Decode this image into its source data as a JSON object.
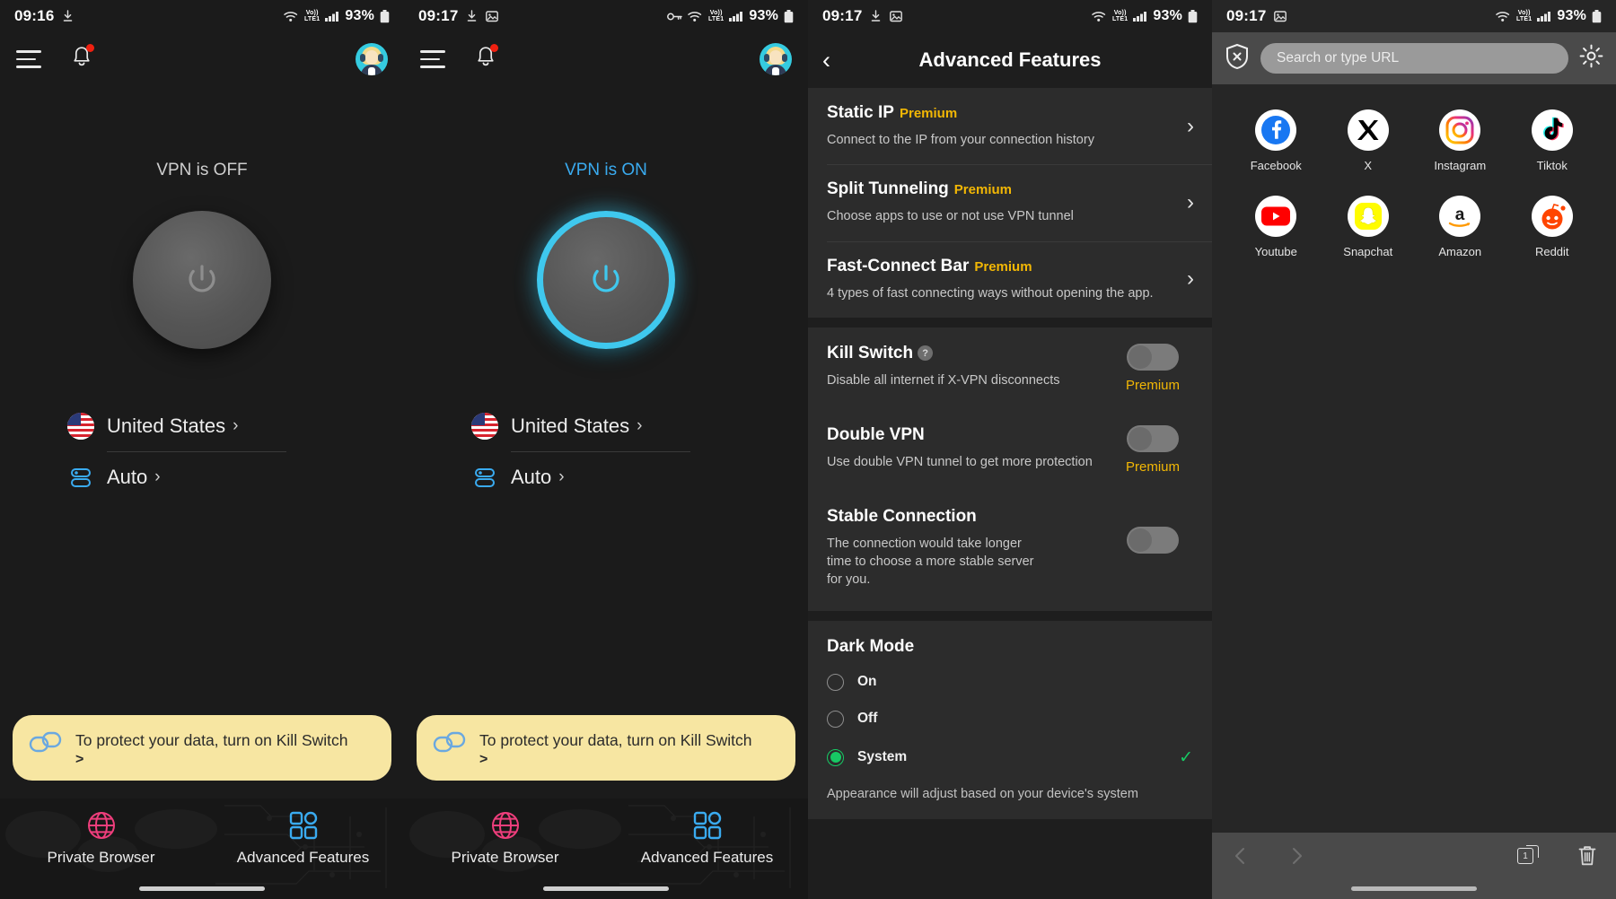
{
  "panels": {
    "vpn_off": {
      "statusbar": {
        "time": "09:16",
        "battery": "93%",
        "network": "LTE1",
        "vol": "Vo))"
      },
      "header": {
        "menu_icon": "hamburger-icon",
        "bell_icon": "bell-icon",
        "avatar": "user-avatar"
      },
      "status_text": "VPN is OFF",
      "power_icon": "power-icon",
      "location": {
        "name": "United States",
        "chevron": "›",
        "flag": "us-flag-icon"
      },
      "protocol": {
        "name": "Auto",
        "chevron": "›",
        "icon": "protocol-icon"
      },
      "banner": {
        "text": "To protect your data, turn on Kill Switch",
        "arrow": ">",
        "icon": "link-icon"
      },
      "bottom": {
        "browser_label": "Private Browser",
        "features_label": "Advanced Features"
      }
    },
    "vpn_on": {
      "statusbar": {
        "time": "09:17",
        "battery": "93%",
        "network": "LTE1",
        "vol": "Vo))"
      },
      "header": {
        "menu_icon": "hamburger-icon",
        "bell_icon": "bell-icon",
        "avatar": "user-avatar"
      },
      "status_text": "VPN is ON",
      "power_icon": "power-icon",
      "location": {
        "name": "United States",
        "chevron": "›",
        "flag": "us-flag-icon"
      },
      "protocol": {
        "name": "Auto",
        "chevron": "›",
        "icon": "protocol-icon"
      },
      "banner": {
        "text": "To protect your data, turn on Kill Switch",
        "arrow": ">",
        "icon": "link-icon"
      },
      "bottom": {
        "browser_label": "Private Browser",
        "features_label": "Advanced Features"
      }
    },
    "advanced": {
      "statusbar": {
        "time": "09:17",
        "battery": "93%",
        "network": "LTE1",
        "vol": "Vo))"
      },
      "title": "Advanced Features",
      "back_icon": "chevron-left-icon",
      "feature_rows": [
        {
          "title": "Static IP",
          "badge": "Premium",
          "subtitle": "Connect to the IP from your connection history",
          "chevron": "›"
        },
        {
          "title": "Split Tunneling",
          "badge": "Premium",
          "subtitle": "Choose apps to use or not use VPN tunnel",
          "chevron": "›"
        },
        {
          "title": "Fast-Connect Bar",
          "badge": "Premium",
          "subtitle": "4 types of fast connecting ways without opening the app.",
          "chevron": "›"
        }
      ],
      "toggle_rows": [
        {
          "title": "Kill Switch",
          "help": "?",
          "subtitle": "Disable all internet if X-VPN disconnects",
          "badge": "Premium",
          "state": "off"
        },
        {
          "title": "Double VPN",
          "help": "",
          "subtitle": "Use double VPN tunnel to get more protection",
          "badge": "Premium",
          "state": "off"
        },
        {
          "title": "Stable Connection",
          "help": "",
          "subtitle": "The connection would take longer time to choose a more stable server for you.",
          "badge": "",
          "state": "off"
        }
      ],
      "dark_mode": {
        "title": "Dark Mode",
        "options": [
          {
            "label": "On",
            "selected": false
          },
          {
            "label": "Off",
            "selected": false
          },
          {
            "label": "System",
            "selected": true
          }
        ],
        "check_icon": "check-icon",
        "footnote": "Appearance will adjust based on your device's system"
      }
    },
    "browser": {
      "statusbar": {
        "time": "09:17",
        "battery": "93%",
        "network": "LTE1",
        "vol": "Vo))"
      },
      "shield_icon": "shield-close-icon",
      "gear_icon": "gear-icon",
      "search": {
        "placeholder": "Search or type URL",
        "value": ""
      },
      "shortcuts": [
        {
          "label": "Facebook",
          "icon": "facebook-icon"
        },
        {
          "label": "X",
          "icon": "x-icon"
        },
        {
          "label": "Instagram",
          "icon": "instagram-icon"
        },
        {
          "label": "Tiktok",
          "icon": "tiktok-icon"
        },
        {
          "label": "Youtube",
          "icon": "youtube-icon"
        },
        {
          "label": "Snapchat",
          "icon": "snapchat-icon"
        },
        {
          "label": "Amazon",
          "icon": "amazon-icon"
        },
        {
          "label": "Reddit",
          "icon": "reddit-icon"
        }
      ],
      "nav": {
        "back_icon": "chevron-left-icon",
        "forward_icon": "chevron-right-icon",
        "tabs_count": "1",
        "tabs_icon": "tabs-icon",
        "delete_icon": "trash-icon"
      }
    }
  },
  "colors": {
    "accent_blue": "#3fc8ee",
    "premium_gold": "#f2b705",
    "banner_yellow": "#f7e6a2",
    "green": "#17c964",
    "pink": "#ef3e7c"
  }
}
